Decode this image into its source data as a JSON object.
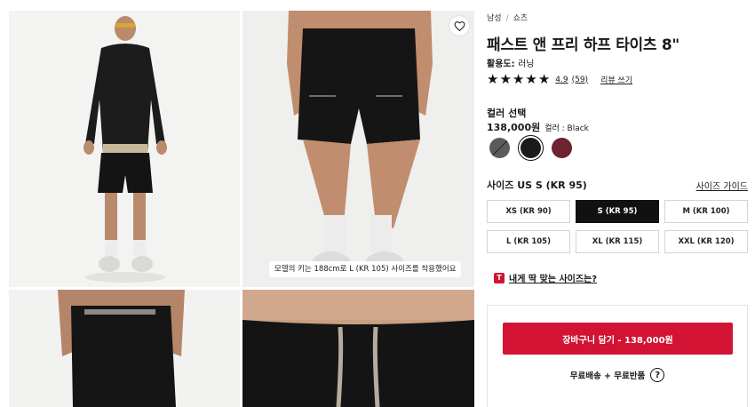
{
  "gallery": {
    "caption": "모델의 키는 188cm로 L (KR 105) 사이즈를 착용했어요",
    "wishlist_icon": "heart-icon"
  },
  "breadcrumb": {
    "level1": "남성",
    "separator": "/",
    "level2": "쇼츠"
  },
  "product": {
    "title": "패스트 앤 프리 하프 타이츠 8\"",
    "activity_label": "활용도:",
    "activity_value": "러닝",
    "rating": {
      "stars": 5,
      "score": "4.9",
      "count": "(59)",
      "write_review": "리뷰 쓰기"
    }
  },
  "color": {
    "heading": "컬러 선택",
    "price": "138,000원",
    "selected_label": "컬러 : Black",
    "swatches": [
      {
        "name": "grey",
        "hex": "#5b5b5b",
        "unavailable": true
      },
      {
        "name": "black",
        "hex": "#1b1b1b",
        "selected": true
      },
      {
        "name": "burgundy",
        "hex": "#6d2330"
      }
    ]
  },
  "size": {
    "heading": "사이즈 US S (KR 95)",
    "guide": "사이즈 가이드",
    "options": [
      "XS (KR 90)",
      "S (KR 95)",
      "M (KR 100)",
      "L (KR 105)",
      "XL (KR 115)",
      "XXL (KR 120)"
    ],
    "selected": "S (KR 95)"
  },
  "fit": {
    "badge": "T",
    "text": "내게 딱 맞는 사이즈는?"
  },
  "cart": {
    "button": "장바구니 담기 - 138,000원",
    "shipping": "무료배송 + 무료반품",
    "help_icon": "?"
  },
  "colors": {
    "accent": "#d31334",
    "selected_size_bg": "#111111"
  }
}
